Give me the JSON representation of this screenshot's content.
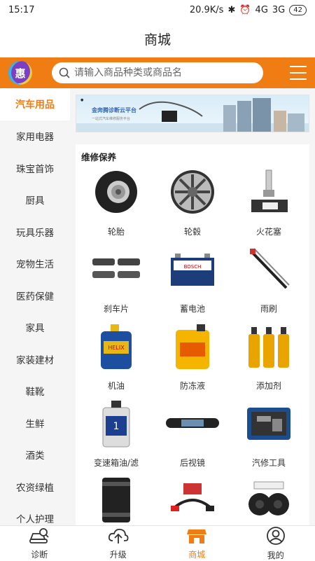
{
  "status_bar": {
    "time": "15:17",
    "network": "20.9K/s",
    "signal1": "4G",
    "signal2": "3G",
    "battery": "42"
  },
  "header": {
    "title": "商城"
  },
  "search": {
    "placeholder": "请输入商品种类或商品名",
    "brand_badge": "惠"
  },
  "sidebar": {
    "items": [
      {
        "label": "汽车用品",
        "active": true
      },
      {
        "label": "家用电器"
      },
      {
        "label": "珠宝首饰"
      },
      {
        "label": "厨具"
      },
      {
        "label": "玩具乐器"
      },
      {
        "label": "宠物生活"
      },
      {
        "label": "医药保健"
      },
      {
        "label": "家具"
      },
      {
        "label": "家装建材"
      },
      {
        "label": "鞋靴"
      },
      {
        "label": "生鲜"
      },
      {
        "label": "酒类"
      },
      {
        "label": "农资绿植"
      },
      {
        "label": "个人护理"
      }
    ]
  },
  "banner": {
    "headline": "金奔腾诊断云平台",
    "subtext": "一站式汽车维修服务平台"
  },
  "section": {
    "title": "维修保养",
    "items": [
      {
        "label": "轮胎",
        "icon": "tire-icon"
      },
      {
        "label": "轮毂",
        "icon": "wheel-rim-icon"
      },
      {
        "label": "火花塞",
        "icon": "spark-plug-icon"
      },
      {
        "label": "刹车片",
        "icon": "brake-pad-icon"
      },
      {
        "label": "蓄电池",
        "icon": "battery-icon"
      },
      {
        "label": "雨刷",
        "icon": "wiper-icon"
      },
      {
        "label": "机油",
        "icon": "engine-oil-icon"
      },
      {
        "label": "防冻液",
        "icon": "antifreeze-icon"
      },
      {
        "label": "添加剂",
        "icon": "additive-icon"
      },
      {
        "label": "变速箱油/滤",
        "icon": "transmission-oil-icon"
      },
      {
        "label": "后视镜",
        "icon": "rearview-mirror-icon"
      },
      {
        "label": "汽修工具",
        "icon": "tool-case-icon"
      },
      {
        "label": "",
        "icon": "oil-filter-icon"
      },
      {
        "label": "",
        "icon": "jumper-cable-icon"
      },
      {
        "label": "",
        "icon": "horn-icon"
      }
    ]
  },
  "tabbar": {
    "items": [
      {
        "label": "诊断",
        "icon": "diagnosis-icon"
      },
      {
        "label": "升级",
        "icon": "cloud-upgrade-icon"
      },
      {
        "label": "商城",
        "icon": "store-icon",
        "active": true
      },
      {
        "label": "我的",
        "icon": "profile-icon"
      }
    ]
  },
  "colors": {
    "accent": "#f07d14",
    "brand_badge": "#7d3fc2"
  }
}
